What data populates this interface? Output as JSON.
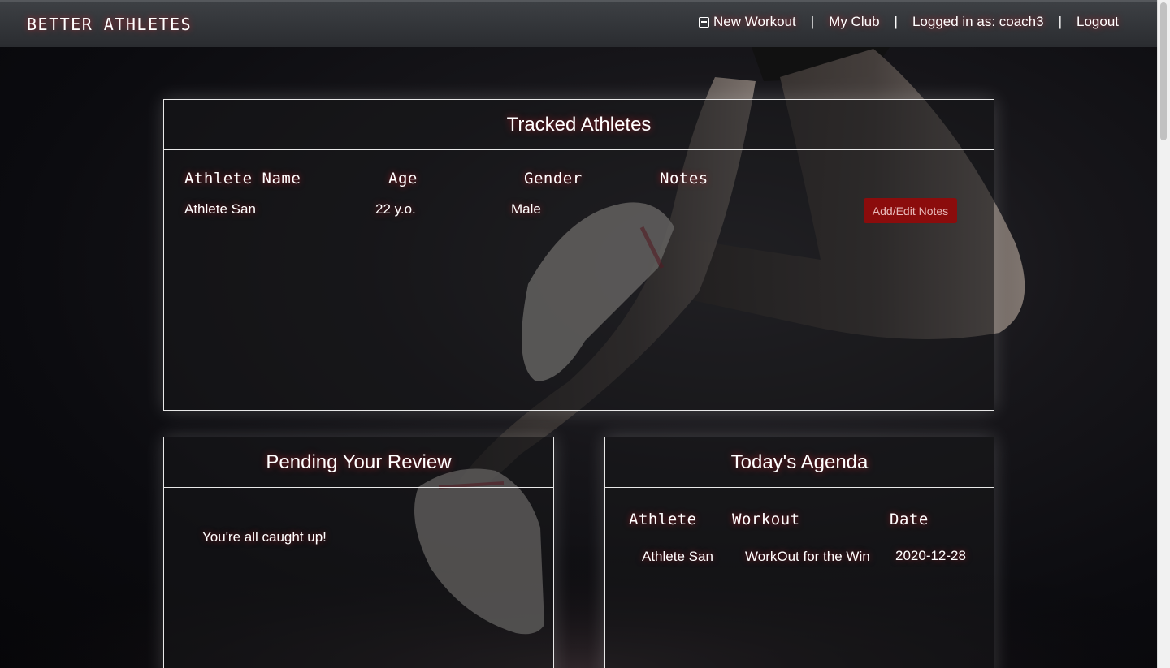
{
  "navbar": {
    "brand": "BETTER ATHLETES",
    "new_workout": "New Workout",
    "my_club": "My Club",
    "logged_in": "Logged in as: coach3",
    "logout": "Logout",
    "separator": "|"
  },
  "tracked_athletes": {
    "title": "Tracked Athletes",
    "columns": [
      "Athlete Name",
      "Age",
      "Gender",
      "Notes"
    ],
    "rows": [
      {
        "name": "Athlete San",
        "age": "22 y.o.",
        "gender": "Male",
        "notes": "",
        "action": "Add/Edit Notes"
      }
    ]
  },
  "pending_review": {
    "title": "Pending Your Review",
    "message": "You're all caught up!"
  },
  "agenda": {
    "title": "Today's Agenda",
    "columns": [
      "Athlete",
      "Workout",
      "Date"
    ],
    "rows": [
      {
        "athlete": "Athlete San",
        "workout": "WorkOut for the Win",
        "date": "2020-12-28"
      }
    ]
  },
  "colors": {
    "accent": "#8b0c0c",
    "glow": "#c81e28",
    "navbar": "#35383c"
  },
  "icons": {
    "new_workout": "plus-square-icon"
  }
}
